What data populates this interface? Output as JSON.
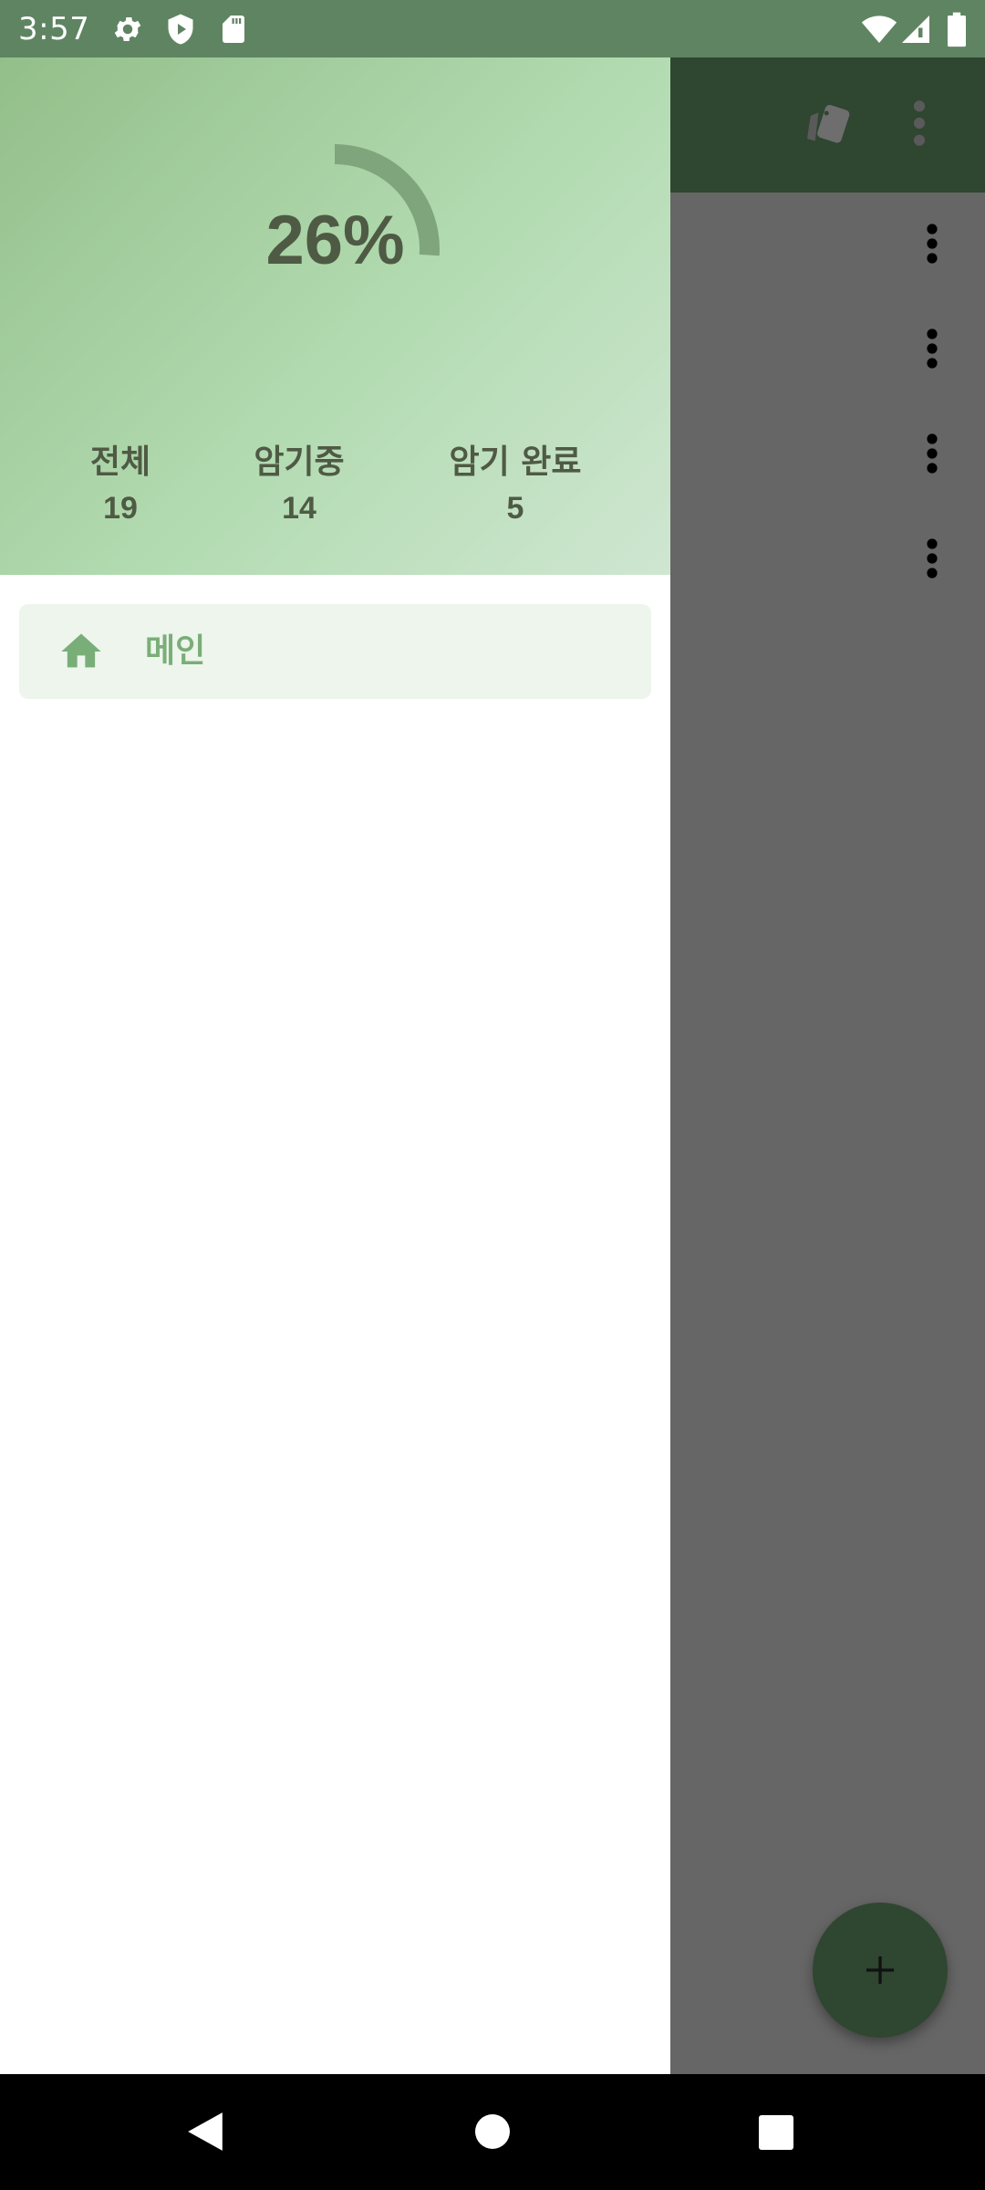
{
  "status_bar": {
    "time": "3:57",
    "icons": [
      "gear-icon",
      "shield-play-icon",
      "sd-card-icon",
      "wifi-icon",
      "signal-icon",
      "battery-icon"
    ]
  },
  "drawer": {
    "header": {
      "progress_percent_text": "26%",
      "progress_fraction": 0.26,
      "stats": [
        {
          "label": "전체",
          "value": "19"
        },
        {
          "label": "암기중",
          "value": "14"
        },
        {
          "label": "암기 완료",
          "value": "5"
        }
      ]
    },
    "menu": [
      {
        "icon": "home-icon",
        "label": "메인"
      }
    ]
  },
  "toolbar": {
    "icons": [
      "cards-icon",
      "overflow-menu-icon"
    ]
  },
  "list": {
    "row_menu_icon": "more-vertical-icon",
    "rows": 4
  },
  "fab": {
    "icon": "plus-icon"
  },
  "nav_bar": {
    "icons": [
      "back-icon",
      "home-circle-icon",
      "recents-icon"
    ]
  },
  "colors": {
    "status_bar": "#5f8462",
    "toolbar": "#2f4631",
    "scrim_bg": "#666666",
    "header_gradient_start": "#93bf8a",
    "header_gradient_end": "#cfe6d1",
    "header_text": "#4f5a44",
    "accent_green": "#7aae78",
    "nav_item_bg": "#edf5ec"
  }
}
